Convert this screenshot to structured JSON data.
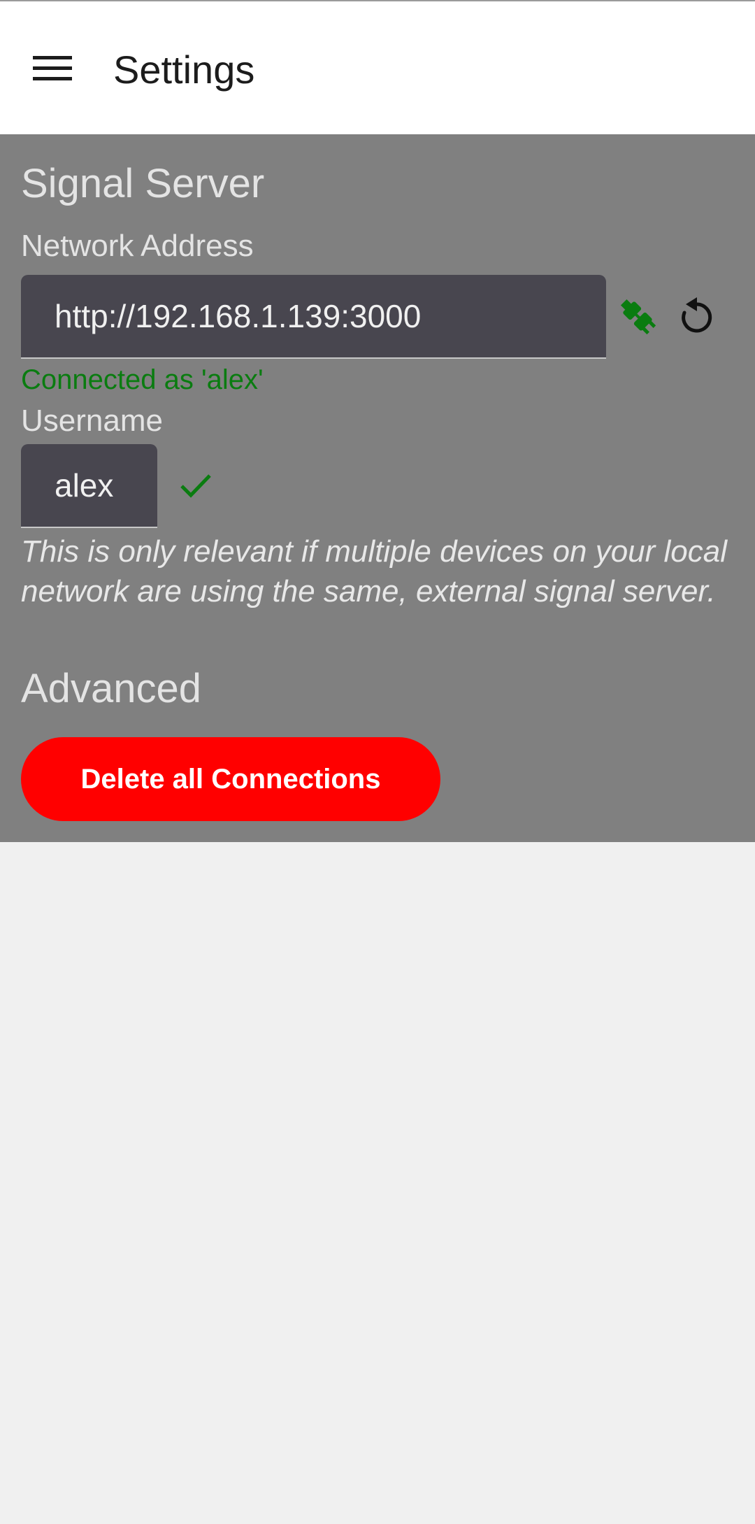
{
  "header": {
    "title": "Settings",
    "menu_icon": "hamburger-menu-icon"
  },
  "signal_server": {
    "section_title": "Signal Server",
    "network_address": {
      "label": "Network Address",
      "value": "http://192.168.1.139:3000",
      "status": "Connected as 'alex'",
      "connected_icon": "plug-connected-icon",
      "reset_icon": "reset-icon"
    },
    "username": {
      "label": "Username",
      "value": "alex",
      "valid_icon": "checkmark-icon"
    },
    "hint": "This is only relevant if multiple devices on your local network are using the same, external signal server."
  },
  "advanced": {
    "section_title": "Advanced",
    "delete_button_label": "Delete all Connections"
  },
  "colors": {
    "panel_background": "#808080",
    "field_background": "#48464f",
    "status_green": "#0a7c10",
    "danger_red": "#ff0000",
    "page_background": "#f0f0f0"
  }
}
